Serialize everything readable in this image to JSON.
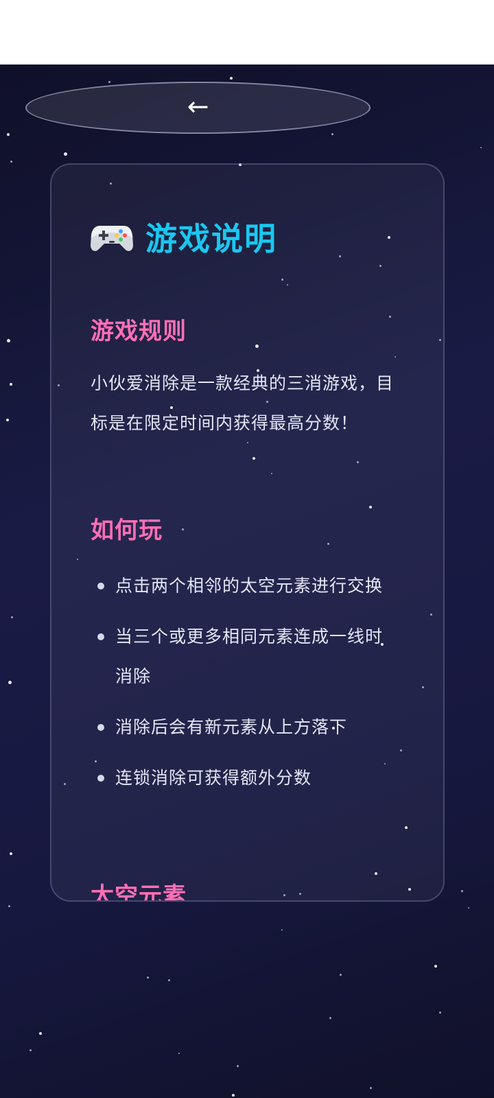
{
  "nav": {
    "back_icon": "←"
  },
  "card": {
    "icon": "gamepad-icon",
    "title": "游戏说明",
    "sections": [
      {
        "heading": "游戏规则",
        "paragraph": "小伙爱消除是一款经典的三消游戏，目标是在限定时间内获得最高分数！"
      },
      {
        "heading": "如何玩",
        "items": [
          "点击两个相邻的太空元素进行交换",
          "当三个或更多相同元素连成一线时消除",
          "消除后会有新元素从上方落下",
          "连锁消除可获得额外分数"
        ]
      },
      {
        "heading": "太空元素"
      }
    ]
  },
  "colors": {
    "title": "#19c8f0",
    "heading": "#ff6fb5",
    "background": "#1a1b45"
  }
}
